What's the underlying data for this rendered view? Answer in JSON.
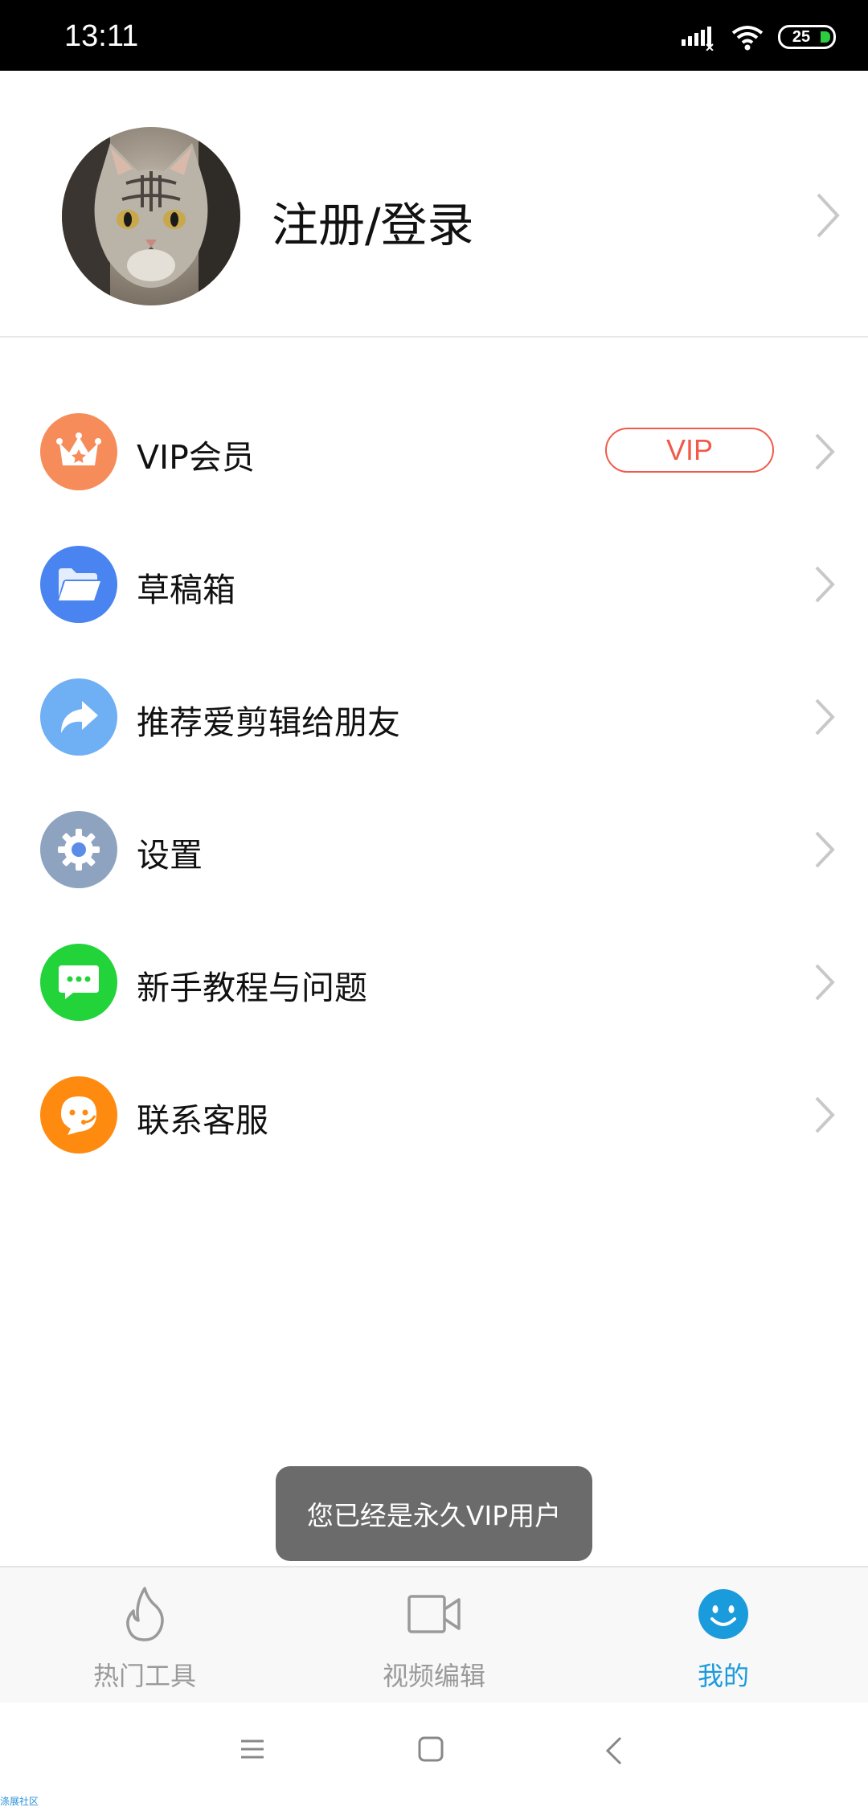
{
  "status_bar": {
    "time": "13:11",
    "battery": "25"
  },
  "profile": {
    "login_label": "注册/登录"
  },
  "menu": {
    "items": [
      {
        "label": "VIP会员",
        "icon": "crown-icon",
        "color": "#f68c5a",
        "badge": "VIP"
      },
      {
        "label": "草稿箱",
        "icon": "folder-icon",
        "color": "#4a84f0"
      },
      {
        "label": "推荐爱剪辑给朋友",
        "icon": "share-icon",
        "color": "#6fb0f5"
      },
      {
        "label": "设置",
        "icon": "gear-icon",
        "color": "#8ea3c0"
      },
      {
        "label": "新手教程与问题",
        "icon": "chat-icon",
        "color": "#22d33a"
      },
      {
        "label": "联系客服",
        "icon": "customer-service-icon",
        "color": "#ff8a10"
      }
    ]
  },
  "toast": {
    "message": "您已经是永久VIP用户"
  },
  "tabbar": {
    "tabs": [
      {
        "label": "热门工具",
        "icon": "flame-icon",
        "active": false
      },
      {
        "label": "视频编辑",
        "icon": "video-camera-icon",
        "active": false
      },
      {
        "label": "我的",
        "icon": "smiley-icon",
        "active": true
      }
    ],
    "active_color": "#1a9bdc",
    "inactive_color": "#9a9a9a"
  },
  "watermark": "涤展社区"
}
